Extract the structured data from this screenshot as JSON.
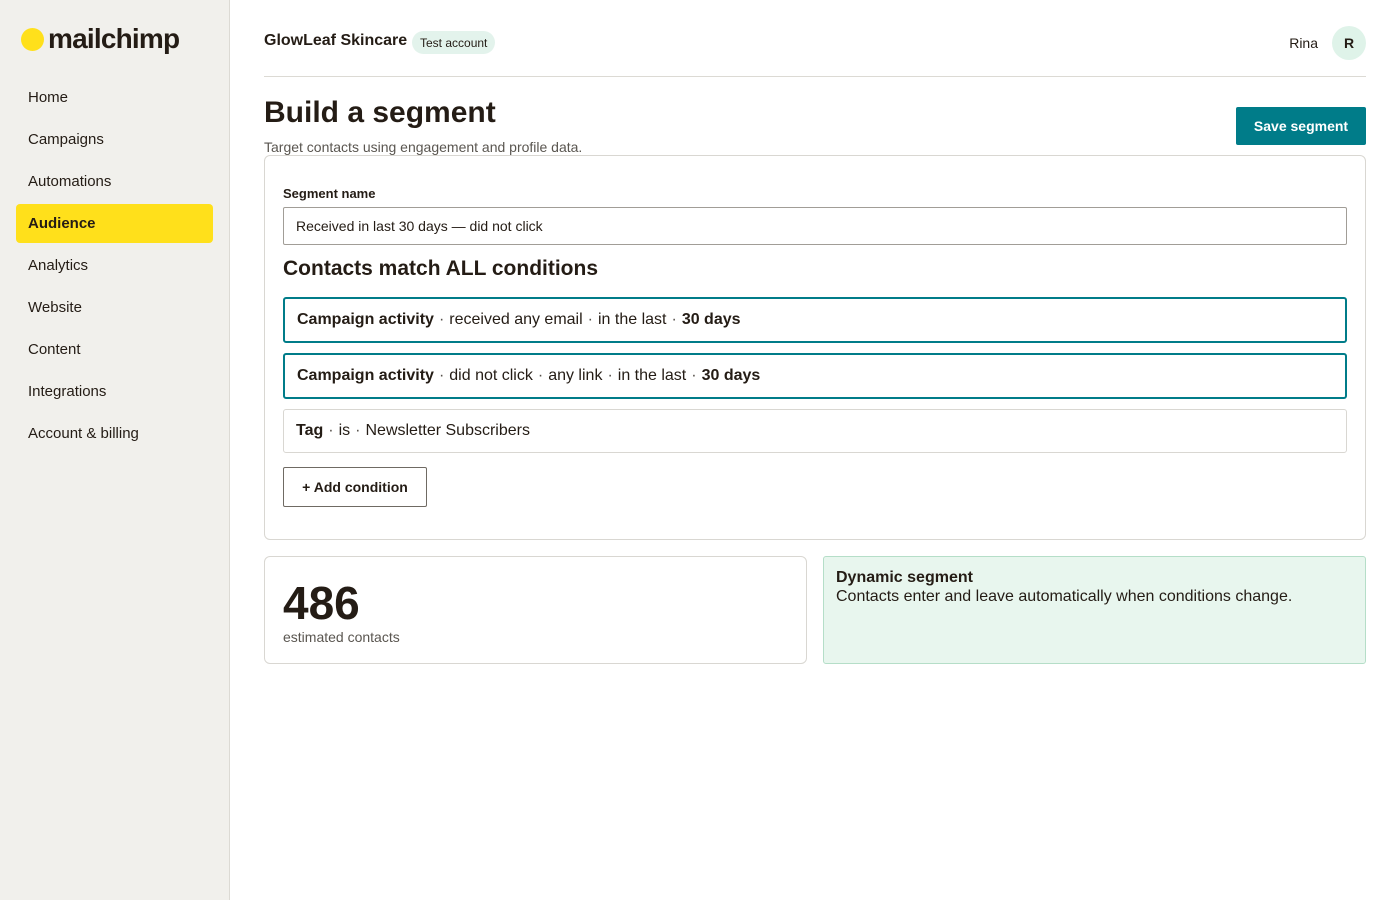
{
  "brand": {
    "name": "mailchimp",
    "accent": "#ffe01b"
  },
  "sidebar": {
    "items": [
      {
        "label": "Home",
        "active": false
      },
      {
        "label": "Campaigns",
        "active": false
      },
      {
        "label": "Automations",
        "active": false
      },
      {
        "label": "Audience",
        "active": true
      },
      {
        "label": "Analytics",
        "active": false
      },
      {
        "label": "Website",
        "active": false
      },
      {
        "label": "Content",
        "active": false
      },
      {
        "label": "Integrations",
        "active": false
      },
      {
        "label": "Account & billing",
        "active": false
      }
    ]
  },
  "header": {
    "org_name": "GlowLeaf Skincare",
    "badge": "Test account",
    "user_name": "Rina",
    "avatar_initial": "R"
  },
  "page": {
    "title": "Build a segment",
    "subtitle": "Target contacts using engagement and profile data.",
    "save_label": "Save segment"
  },
  "segment": {
    "name_label": "Segment name",
    "name_value": "Received in last 30 days — did not click",
    "conditions_heading": "Contacts match ALL conditions",
    "conditions": [
      {
        "field": "Campaign activity",
        "op": "received any email",
        "scope": "in the last",
        "value": "30 days"
      },
      {
        "field": "Campaign activity",
        "op": "did not click",
        "target": "any link",
        "scope": "in the last",
        "value": "30 days"
      },
      {
        "field": "Tag",
        "op": "is",
        "value": "Newsletter Subscribers"
      }
    ],
    "separator": "·",
    "add_condition_label": "+ Add condition"
  },
  "summary": {
    "count": "486",
    "count_label": "estimated contacts",
    "info_title": "Dynamic segment",
    "info_text": "Contacts enter and leave automatically when conditions change."
  },
  "colors": {
    "primary": "#007c89",
    "sidebar_bg": "#f1f0ec",
    "info_bg": "#e8f6ee"
  }
}
